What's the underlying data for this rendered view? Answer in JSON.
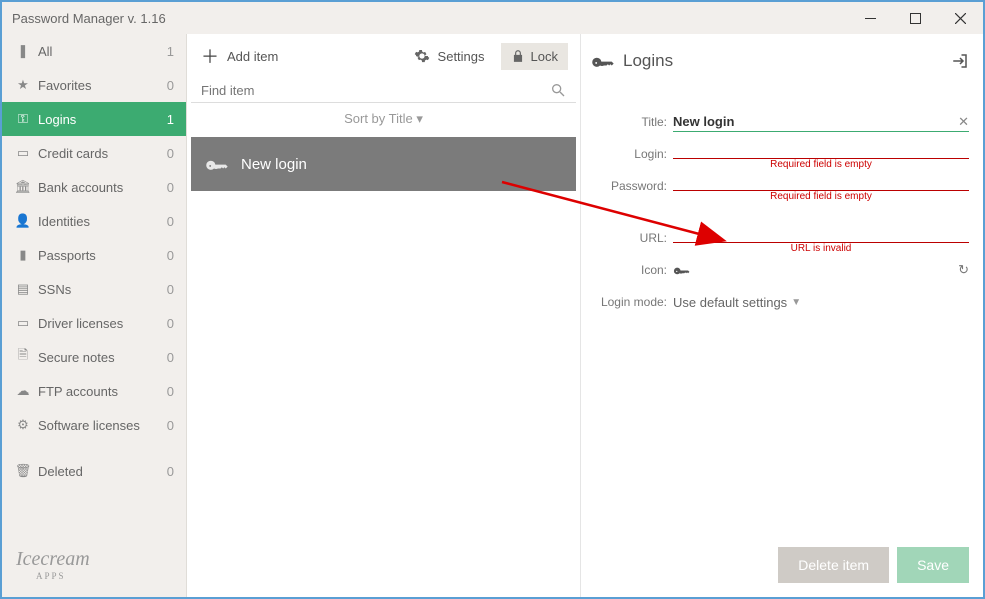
{
  "window": {
    "title": "Password Manager v. 1.16"
  },
  "toolbar": {
    "add_item": "Add item",
    "settings": "Settings",
    "lock": "Lock"
  },
  "search": {
    "placeholder": "Find item"
  },
  "sort": {
    "label": "Sort by Title",
    "caret": "▾"
  },
  "sidebar": {
    "items": [
      {
        "label": "All",
        "count": "1"
      },
      {
        "label": "Favorites",
        "count": "0"
      },
      {
        "label": "Logins",
        "count": "1"
      },
      {
        "label": "Credit cards",
        "count": "0"
      },
      {
        "label": "Bank accounts",
        "count": "0"
      },
      {
        "label": "Identities",
        "count": "0"
      },
      {
        "label": "Passports",
        "count": "0"
      },
      {
        "label": "SSNs",
        "count": "0"
      },
      {
        "label": "Driver licenses",
        "count": "0"
      },
      {
        "label": "Secure notes",
        "count": "0"
      },
      {
        "label": "FTP accounts",
        "count": "0"
      },
      {
        "label": "Software licenses",
        "count": "0"
      },
      {
        "label": "Deleted",
        "count": "0"
      }
    ]
  },
  "brand": {
    "line1": "Icecream",
    "line2": "APPS"
  },
  "list": {
    "items": [
      {
        "title": "New login"
      }
    ]
  },
  "detail": {
    "header": "Logins",
    "fields": {
      "title_label": "Title:",
      "title_value": "New login",
      "login_label": "Login:",
      "login_err": "Required field is empty",
      "password_label": "Password:",
      "password_err": "Required field is empty",
      "url_label": "URL:",
      "url_err": "URL is invalid",
      "icon_label": "Icon:",
      "mode_label": "Login mode:",
      "mode_value": "Use default settings"
    },
    "buttons": {
      "delete": "Delete item",
      "save": "Save"
    }
  }
}
